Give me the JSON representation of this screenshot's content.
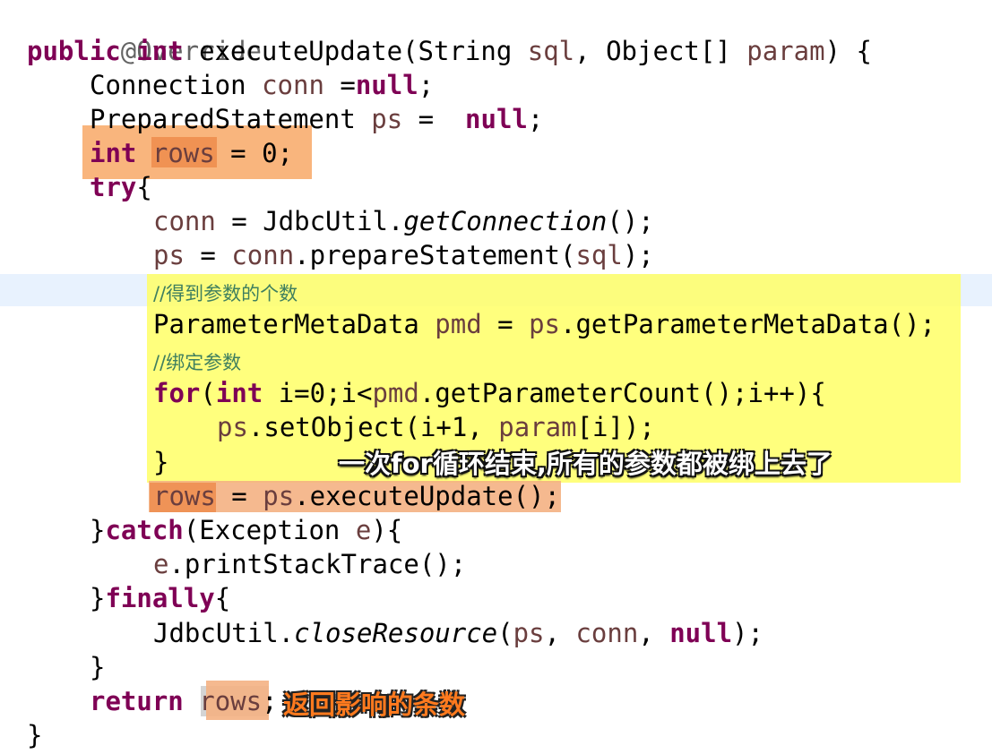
{
  "code": {
    "line1": {
      "annotation": "@Override"
    },
    "line2": {
      "kw1": "public",
      "kw2": "int",
      "sig_a": "executeUpdate(String",
      "p1": "sql",
      "sig_b": ", Object[]",
      "p2": "param",
      "sig_c": ") {"
    },
    "line3": {
      "type": "Connection",
      "var": "conn",
      "eq": " =",
      "kw": "null",
      "end": ";"
    },
    "line4": {
      "type": "PreparedStatement",
      "var": "ps",
      "eq": " =  ",
      "kw": "null",
      "end": ";"
    },
    "line5": {
      "kw": "int",
      "var": "rows",
      "rest": " = 0;"
    },
    "line6": {
      "kw": "try",
      "rest": "{"
    },
    "line7": {
      "var": "conn",
      "a": " = JdbcUtil.",
      "method": "getConnection",
      "b": "();"
    },
    "line8": {
      "var1": "ps",
      "a": " = ",
      "var2": "conn",
      "b": ".prepareStatement(",
      "var3": "sql",
      "c": ");"
    },
    "line9": {
      "comment": "//得到参数的个数"
    },
    "line10": {
      "type": "ParameterMetaData",
      "var1": "pmd",
      "a": " = ",
      "var2": "ps",
      "b": ".getParameterMetaData();"
    },
    "line11": {
      "comment": "//绑定参数"
    },
    "line12": {
      "kw1": "for",
      "a": "(",
      "kw2": "int",
      "b": " i=0;i<",
      "var": "pmd",
      "c": ".getParameterCount();i++){"
    },
    "line13": {
      "var1": "ps",
      "a": ".setObject(i+1, ",
      "var2": "param",
      "b": "[i]);"
    },
    "line14": {
      "text": "}"
    },
    "line15": {
      "var1": "rows",
      "a": " = ",
      "var2": "ps",
      "b": ".executeUpdate();"
    },
    "line16": {
      "a": "}",
      "kw": "catch",
      "b": "(Exception ",
      "var": "e",
      "c": "){"
    },
    "line17": {
      "var": "e",
      "a": ".printStackTrace();"
    },
    "line18": {
      "a": "}",
      "kw": "finally",
      "b": "{"
    },
    "line19": {
      "a": "JdbcUtil.",
      "method": "closeResource",
      "b": "(",
      "var1": "ps",
      "c": ", ",
      "var2": "conn",
      "d": ", ",
      "kw": "null",
      "e": ");"
    },
    "line20": {
      "text": "}"
    },
    "line21": {
      "kw": "return",
      "var": "rows",
      "end": ";"
    },
    "line22": {
      "text": "}"
    }
  },
  "callouts": {
    "loop_note": "一次for循环结束,所有的参数都被绑上去了",
    "return_note": "返回影响的条数"
  },
  "colors": {
    "keyword": "#7f0055",
    "variable": "#6a3e3e",
    "comment": "#3f7f5f",
    "annotation": "#646464",
    "highlight_yellow": "#ffff66",
    "highlight_orange": "#f7a35c",
    "current_line": "#e8f2fe"
  }
}
